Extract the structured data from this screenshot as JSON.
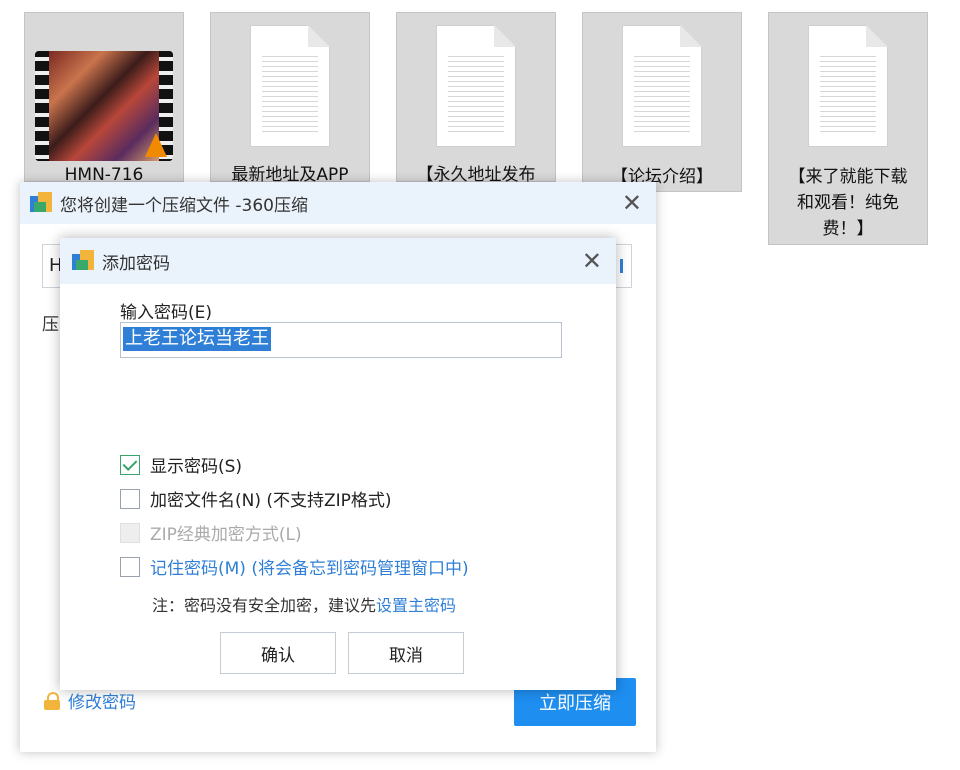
{
  "desktop_files": [
    {
      "name": "HMN-716",
      "type": "video"
    },
    {
      "name": "最新地址及APP",
      "type": "document"
    },
    {
      "name": "【永久地址发布",
      "type": "document"
    },
    {
      "name": "【论坛介绍】",
      "type": "document"
    },
    {
      "name_lines": [
        "【来了就能下载",
        "和观看！纯免",
        "费！】"
      ],
      "type": "document"
    }
  ],
  "main_dialog": {
    "title": "您将创建一个压缩文件 -360压缩",
    "path_value": "H",
    "left_label": "压",
    "modify_password": "修改密码",
    "compress_now": "立即压缩"
  },
  "password_dialog": {
    "title": "添加密码",
    "input_label": "输入密码(E)",
    "password_value": "上老王论坛当老王",
    "options": {
      "show_password": {
        "label": "显示密码(S)",
        "checked": true
      },
      "encrypt_filenames": {
        "label": "加密文件名(N) (不支持ZIP格式)",
        "checked": false
      },
      "zip_classic": {
        "label": "ZIP经典加密方式(L)",
        "disabled": true
      },
      "remember_password": {
        "label": "记住密码(M) (将会备忘到密码管理窗口中)",
        "checked": false
      }
    },
    "note_prefix": "注：密码没有安全加密，建议先",
    "note_link": "设置主密码",
    "confirm": "确认",
    "cancel": "取消"
  },
  "colors": {
    "accent": "#1e8ef0",
    "titlebar": "#eaf2fb",
    "check": "#3aa36a"
  }
}
